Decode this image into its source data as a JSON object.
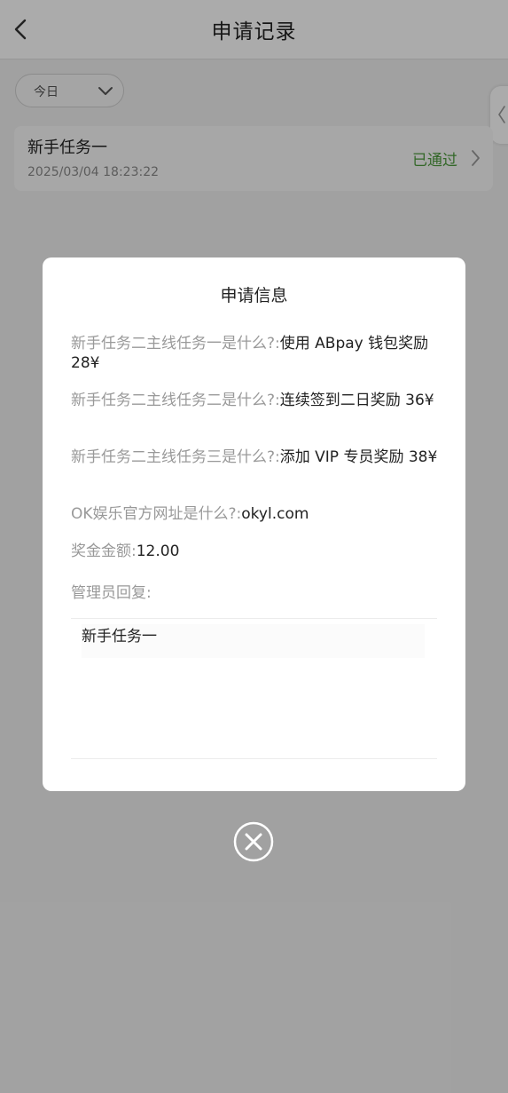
{
  "header": {
    "title": "申请记录"
  },
  "filter": {
    "selected": "今日"
  },
  "records": [
    {
      "title": "新手任务一",
      "time": "2025/03/04 18:23:22",
      "status": "已通过"
    }
  ],
  "modal": {
    "title": "申请信息",
    "qa": [
      {
        "question": "新手任务二主线任务一是什么?:",
        "answer": "使用 ABpay 钱包奖励 28¥"
      },
      {
        "question": "新手任务二主线任务二是什么?:",
        "answer": "连续签到二日奖励 36¥"
      },
      {
        "question": "新手任务二主线任务三是什么?:",
        "answer": "添加 VIP 专员奖励 38¥"
      },
      {
        "question": "OK娱乐官方网址是什么?:",
        "answer": "okyl.com"
      },
      {
        "question": "奖金金额:",
        "answer": "12.00"
      }
    ],
    "reply_label": "管理员回复:",
    "reply_text": "新手任务一"
  },
  "colors": {
    "status_green": "#4c9a3c",
    "question_gray": "#999999"
  },
  "icons": {
    "back": "chevron-left-icon",
    "dropdown": "chevron-down-icon",
    "record": "chevron-right-icon",
    "close": "close-circle-icon"
  }
}
